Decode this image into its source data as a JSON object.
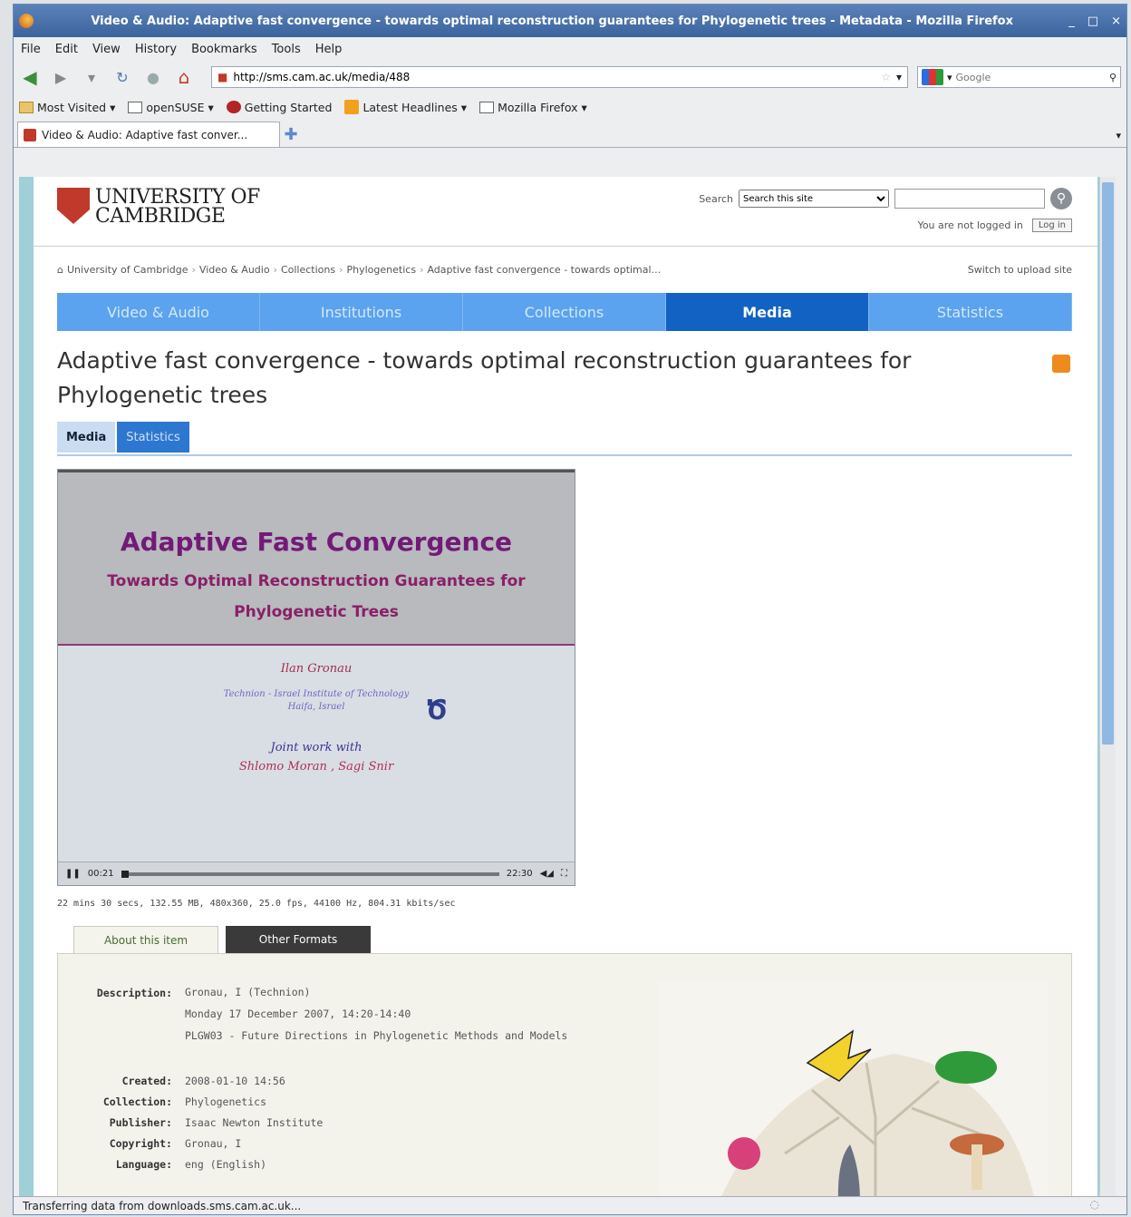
{
  "window": {
    "title": "Video & Audio: Adaptive fast convergence - towards optimal reconstruction guarantees for Phylogenetic trees - Metadata - Mozilla Firefox",
    "controls": [
      "_",
      "□",
      "×"
    ]
  },
  "menu": [
    "File",
    "Edit",
    "View",
    "History",
    "Bookmarks",
    "Tools",
    "Help"
  ],
  "nav": {
    "url": "http://sms.cam.ac.uk/media/488",
    "search_placeholder": "Google"
  },
  "bookmarks": [
    "Most Visited",
    "openSUSE",
    "Getting Started",
    "Latest Headlines",
    "Mozilla Firefox"
  ],
  "tab": {
    "label": "Video & Audio: Adaptive fast conver..."
  },
  "site": {
    "logo_line1": "UNIVERSITY OF",
    "logo_line2": "CAMBRIDGE",
    "search_label": "Search",
    "search_scope": "Search this site",
    "login_text": "You are not logged in",
    "login_button": "Log in",
    "breadcrumbs": [
      "University of Cambridge",
      "Video & Audio",
      "Collections",
      "Phylogenetics",
      "Adaptive fast convergence - towards optimal..."
    ],
    "switch_link": "Switch to upload site",
    "mainnav": [
      "Video & Audio",
      "Institutions",
      "Collections",
      "Media",
      "Statistics"
    ],
    "mainnav_active": "Media",
    "page_title": "Adaptive fast convergence - towards optimal reconstruction guarantees for Phylogenetic trees",
    "subtabs": [
      "Media",
      "Statistics"
    ]
  },
  "video": {
    "slide_title": "Adaptive Fast Convergence",
    "slide_subtitle_1": "Towards Optimal Reconstruction Guarantees for",
    "slide_subtitle_2": "Phylogenetic Trees",
    "author": "Ilan Gronau",
    "affiliation_1": "Technion - Israel Institute of Technology",
    "affiliation_2": "Haifa,    Israel",
    "joint": "Joint work with",
    "coauthors": "Shlomo Moran , Sagi Snir",
    "elapsed": "00:21",
    "duration": "22:30",
    "progress": 0.02,
    "info": "22 mins 30 secs, 132.55 MB, 480x360, 25.0 fps, 44100 Hz, 804.31 kbits/sec"
  },
  "info_tabs": [
    "About this item",
    "Other Formats"
  ],
  "fields": {
    "description_label": "Description:",
    "description_1": "Gronau, I (Technion)",
    "description_2": "Monday 17 December 2007, 14:20-14:40",
    "description_3": "PLGW03 - Future Directions in Phylogenetic Methods and Models",
    "created_label": "Created:",
    "created": "2008-01-10 14:56",
    "collection_label": "Collection:",
    "collection": "Phylogenetics",
    "publisher_label": "Publisher:",
    "publisher": "Isaac Newton Institute",
    "copyright_label": "Copyright:",
    "copyright": "Gronau, I",
    "language_label": "Language:",
    "language": "eng (English)"
  },
  "status": "Transferring data from downloads.sms.cam.ac.uk..."
}
